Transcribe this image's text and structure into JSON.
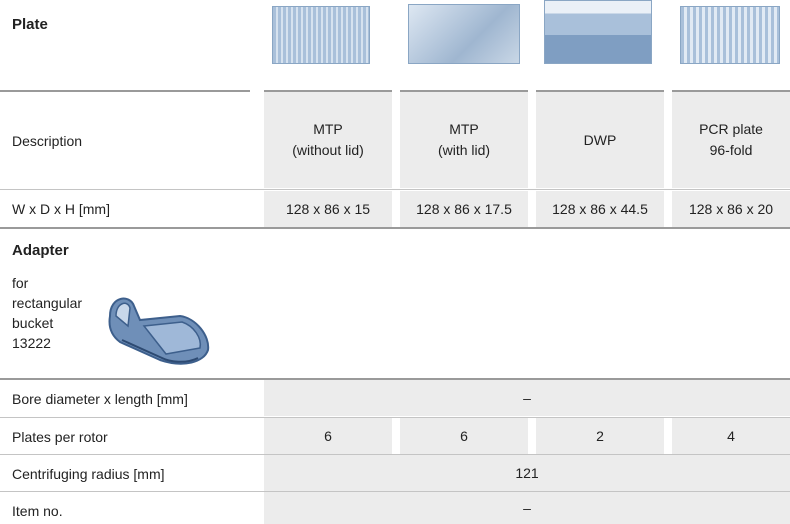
{
  "plate": {
    "heading": "Plate",
    "columns": [
      {
        "type": "MTP",
        "detail": "(without lid)",
        "dimensions": "128 x 86 x 15",
        "image": "mtp-plate-image"
      },
      {
        "type": "MTP",
        "detail": "(with lid)",
        "dimensions": "128 x 86 x 17.5",
        "image": "mtp-lid-plate-image"
      },
      {
        "type": "DWP",
        "detail": "",
        "dimensions": "128 x 86 x 44.5",
        "image": "dwp-plate-image"
      },
      {
        "type": "PCR plate",
        "detail": "96-fold",
        "dimensions": "128 x 86 x 20",
        "image": "pcr-plate-image"
      }
    ],
    "description_label": "Description",
    "dimensions_label": "W x D x H [mm]"
  },
  "adapter": {
    "heading": "Adapter",
    "for_label_lines": [
      "for",
      "rectangular",
      "bucket",
      "13222"
    ],
    "image": "bucket-adapter-image",
    "bore_label": "Bore diameter x length [mm]",
    "bore_value": "–",
    "plates_label": "Plates per rotor",
    "plates_values": [
      "6",
      "6",
      "2",
      "4"
    ],
    "radius_label": "Centrifuging radius [mm]",
    "radius_value": "121",
    "item_label": "Item no.",
    "item_value": "–"
  },
  "colors": {
    "cell_bg": "#ececec",
    "plate_blue": "#9fb8d4",
    "rule": "#9a9a9a"
  }
}
